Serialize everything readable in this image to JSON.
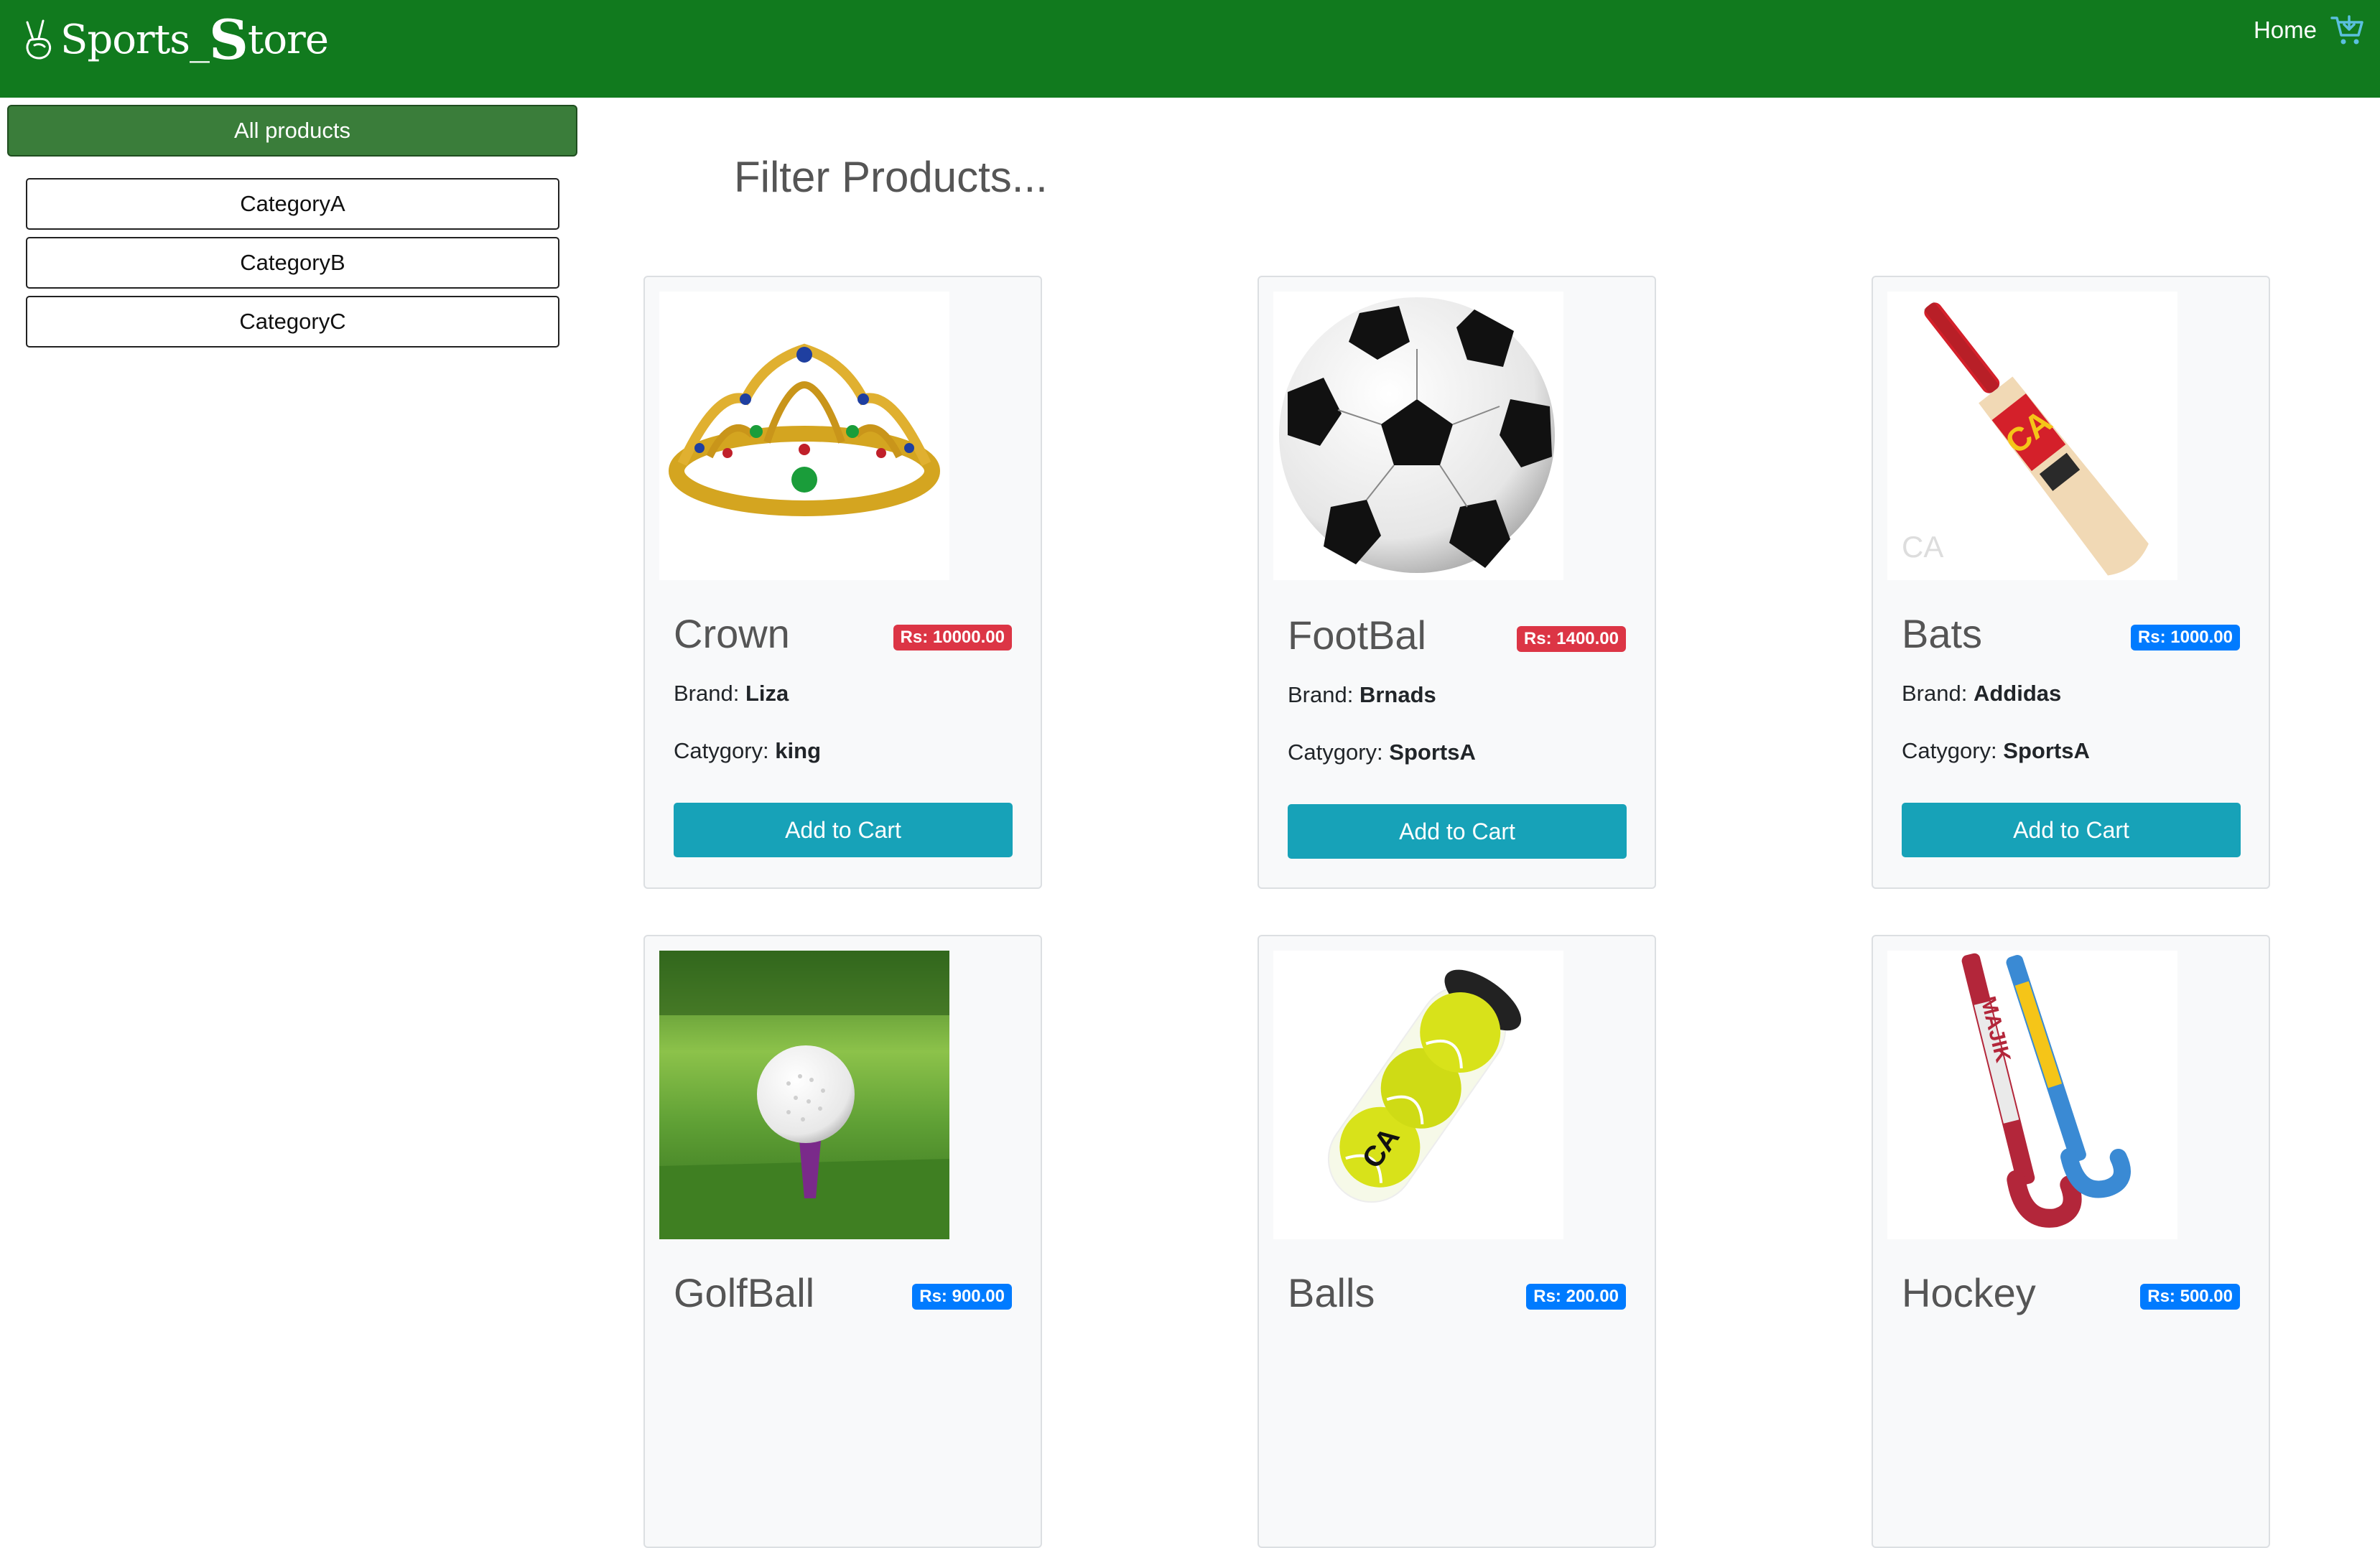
{
  "navbar": {
    "brand_prefix": "Sports_",
    "brand_s": "S",
    "brand_suffix": "tore",
    "home_label": "Home",
    "cart_icon": "cart-icon",
    "logo_icon": "peace-hand-icon",
    "background": "#117a1e"
  },
  "sidebar": {
    "all_products_label": "All products",
    "categories": [
      "CategoryA",
      "CategoryB",
      "CategoryC"
    ]
  },
  "main": {
    "title": "Filter Products..."
  },
  "cart_button_label": "Add to Cart",
  "labels": {
    "brand": "Brand: ",
    "category": "Catygory: "
  },
  "products": [
    {
      "name": "Crown",
      "price": "Rs: 10000.00",
      "badge_color": "#dc3545",
      "brand": "Liza",
      "category": "king",
      "image": "crown-image"
    },
    {
      "name": "FootBal",
      "price": "Rs: 1400.00",
      "badge_color": "#dc3545",
      "brand": "Brnads",
      "category": "SportsA",
      "image": "football-image"
    },
    {
      "name": "Bats",
      "price": "Rs: 1000.00",
      "badge_color": "#007bff",
      "brand": "Addidas",
      "category": "SportsA",
      "image": "cricket-bat-image"
    },
    {
      "name": "GolfBall",
      "price": "Rs: 900.00",
      "badge_color": "#007bff",
      "image": "golf-ball-image"
    },
    {
      "name": "Balls",
      "price": "Rs: 200.00",
      "badge_color": "#007bff",
      "image": "tennis-balls-image"
    },
    {
      "name": "Hockey",
      "price": "Rs: 500.00",
      "badge_color": "#007bff",
      "image": "hockey-sticks-image"
    }
  ]
}
